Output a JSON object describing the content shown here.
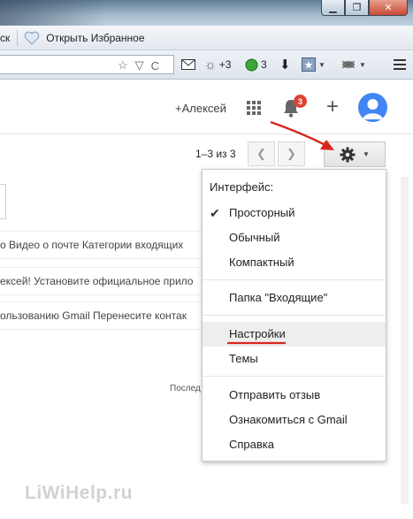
{
  "favorites_bar": {
    "left_fragment": "ск",
    "open_favorites_label": "Открыть Избранное"
  },
  "toolbar": {
    "weather_count": "+3",
    "green_count": "3"
  },
  "gmail_header": {
    "account_link": "+Алексей",
    "notification_count": "3",
    "share_label": "+"
  },
  "pagination": {
    "text": "1–3 из 3"
  },
  "inbox_rows": [
    "о Видео о почте Категории входящих",
    "ексей! Установите официальное прило",
    "ользованию Gmail Перенесите контак"
  ],
  "footer_fragment": "Послед",
  "settings_menu": {
    "heading": "Интерфейс:",
    "density": [
      {
        "label": "Просторный",
        "checked": true
      },
      {
        "label": "Обычный",
        "checked": false
      },
      {
        "label": "Компактный",
        "checked": false
      }
    ],
    "inbox_folder": "Папка \"Входящие\"",
    "settings": "Настройки",
    "themes": "Темы",
    "feedback": "Отправить отзыв",
    "learn": "Ознакомиться с Gmail",
    "help": "Справка"
  },
  "watermark": "LiWiHelp.ru",
  "colors": {
    "badge_red": "#db4437",
    "avatar_blue": "#4285f4",
    "annotation_red": "#d9261c"
  }
}
